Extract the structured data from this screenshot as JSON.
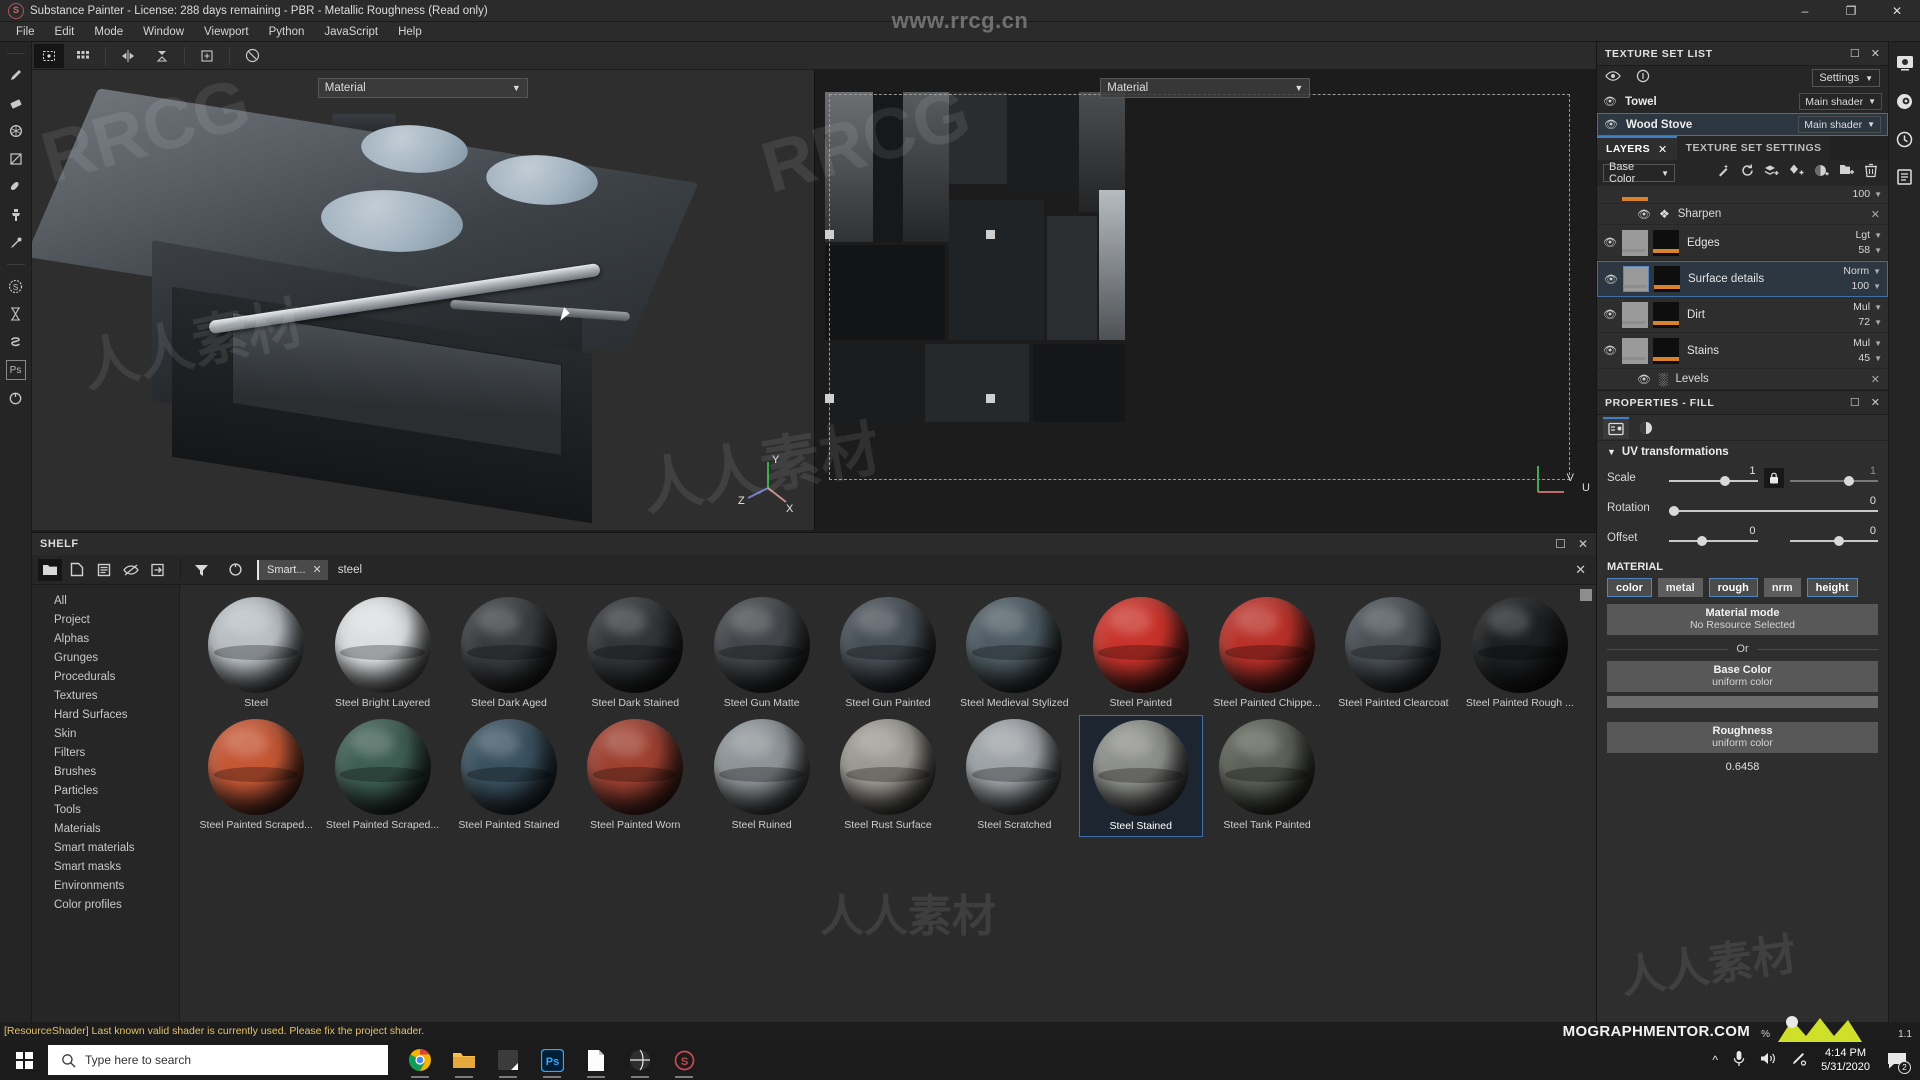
{
  "window": {
    "title": "Substance Painter - License: 288 days remaining - PBR - Metallic Roughness (Read only)",
    "minimize": "–",
    "maximize": "❐",
    "close": "✕"
  },
  "menu": {
    "items": [
      "File",
      "Edit",
      "Mode",
      "Window",
      "Viewport",
      "Python",
      "JavaScript",
      "Help"
    ]
  },
  "watermarks": {
    "url": "www.rrcg.cn",
    "cn": "人人素材",
    "rrcg": "RRCG"
  },
  "viewport3d": {
    "material_dropdown": "Material",
    "axis": {
      "x": "X",
      "y": "Y",
      "z": "Z"
    }
  },
  "viewport2d": {
    "material_dropdown": "Material",
    "u_label": "U",
    "v_label": "V"
  },
  "texture_set_list": {
    "title": "TEXTURE SET LIST",
    "settings_label": "Settings",
    "items": [
      {
        "name": "Towel",
        "shader": "Main shader",
        "selected": false
      },
      {
        "name": "Wood Stove",
        "shader": "Main shader",
        "selected": true
      }
    ]
  },
  "layers_panel": {
    "tabs": [
      {
        "label": "LAYERS",
        "active": true,
        "closable": true
      },
      {
        "label": "TEXTURE SET SETTINGS",
        "active": false,
        "closable": false
      }
    ],
    "channel": "Base Color",
    "rows": [
      {
        "type": "partial",
        "opacity": "100"
      },
      {
        "type": "effect",
        "name": "Sharpen",
        "icon": "sharpen-icon"
      },
      {
        "type": "layer",
        "name": "Edges",
        "blend": "Lgt",
        "opacity": "58",
        "selected": false
      },
      {
        "type": "layer",
        "name": "Surface details",
        "blend": "Norm",
        "opacity": "100",
        "selected": true
      },
      {
        "type": "layer",
        "name": "Dirt",
        "blend": "Mul",
        "opacity": "72",
        "selected": false
      },
      {
        "type": "layer",
        "name": "Stains",
        "blend": "Mul",
        "opacity": "45",
        "selected": false
      },
      {
        "type": "effect",
        "name": "Levels",
        "icon": "levels-icon"
      }
    ]
  },
  "properties": {
    "title": "PROPERTIES - FILL",
    "section": "UV transformations",
    "rows": [
      {
        "label": "Scale",
        "v1": "1",
        "v2": "1",
        "locked": true
      },
      {
        "label": "Rotation",
        "v1": "",
        "v2": "0",
        "locked": false
      },
      {
        "label": "Offset",
        "v1": "0",
        "v2": "0",
        "locked": false
      }
    ],
    "material_title": "MATERIAL",
    "channels": [
      {
        "label": "color",
        "on": true
      },
      {
        "label": "metal",
        "on": false
      },
      {
        "label": "rough",
        "on": true
      },
      {
        "label": "nrm",
        "on": false
      },
      {
        "label": "height",
        "on": true
      }
    ],
    "material_mode": {
      "title": "Material mode",
      "sub": "No Resource Selected"
    },
    "or_label": "Or",
    "base_color": {
      "title": "Base Color",
      "sub": "uniform color"
    },
    "roughness": {
      "title": "Roughness",
      "sub": "uniform color",
      "value": "0.6458"
    }
  },
  "shelf": {
    "title": "SHELF",
    "search_value": "steel",
    "filter_chip": "Smart...",
    "categories": [
      "All",
      "Project",
      "Alphas",
      "Grunges",
      "Procedurals",
      "Textures",
      "Hard Surfaces",
      "Skin",
      "Filters",
      "Brushes",
      "Particles",
      "Tools",
      "Materials",
      "Smart materials",
      "Smart masks",
      "Environments",
      "Color profiles"
    ],
    "items": [
      {
        "name": "Steel",
        "color": "#b9bfc4",
        "selected": false
      },
      {
        "name": "Steel Bright Layered",
        "color": "#dcdfe1",
        "selected": false
      },
      {
        "name": "Steel Dark Aged",
        "color": "#3a3d40",
        "selected": false
      },
      {
        "name": "Steel Dark Stained",
        "color": "#333639",
        "selected": false
      },
      {
        "name": "Steel Gun Matte",
        "color": "#43474b",
        "selected": false
      },
      {
        "name": "Steel Gun Painted",
        "color": "#474f57",
        "selected": false
      },
      {
        "name": "Steel Medieval Stylized",
        "color": "#4e5c64",
        "selected": false
      },
      {
        "name": "Steel Painted",
        "color": "#c8322a",
        "selected": false
      },
      {
        "name": "Steel Painted Chippe...",
        "color": "#b93028",
        "selected": false
      },
      {
        "name": "Steel Painted Clearcoat",
        "color": "#4a5056",
        "selected": false
      },
      {
        "name": "Steel Painted Rough ...",
        "color": "#1d1f21",
        "selected": false
      },
      {
        "name": "Steel Painted Scraped...",
        "color": "#c45634",
        "selected": false
      },
      {
        "name": "Steel Painted Scraped...",
        "color": "#3e5e53",
        "selected": false
      },
      {
        "name": "Steel Painted Stained",
        "color": "#3a5160",
        "selected": false
      },
      {
        "name": "Steel Painted Worn",
        "color": "#9e4030",
        "selected": false
      },
      {
        "name": "Steel Ruined",
        "color": "#8e9498",
        "selected": false
      },
      {
        "name": "Steel Rust Surface",
        "color": "#9d9a93",
        "selected": false
      },
      {
        "name": "Steel Scratched",
        "color": "#9ea3a7",
        "selected": false
      },
      {
        "name": "Steel Stained",
        "color": "#8d8f8a",
        "selected": true
      },
      {
        "name": "Steel Tank Painted",
        "color": "#5d6258",
        "selected": false
      }
    ]
  },
  "status": {
    "message": "[ResourceShader] Last known valid shader is currently used. Please fix the project shader."
  },
  "overlay": {
    "brand": "MOGRAPHMENTOR.COM",
    "percent": "%",
    "version": "1.1"
  },
  "taskbar": {
    "search_placeholder": "Type here to search",
    "apps": [
      "chrome-icon",
      "explorer-icon",
      "notepad-icon",
      "photoshop-icon",
      "file-icon",
      "browser-icon",
      "substance-icon"
    ],
    "tray_icons": [
      "chevron-up-icon",
      "microphone-icon",
      "speaker-icon",
      "pen-icon"
    ],
    "time": "4:14 PM",
    "date": "5/31/2020",
    "notification_count": "2"
  }
}
